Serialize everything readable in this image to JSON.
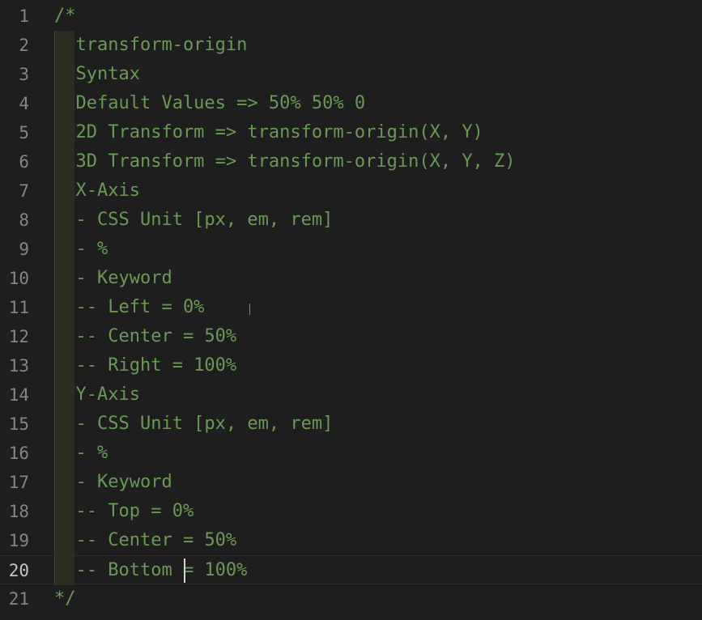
{
  "editor": {
    "current_line": 20,
    "lines": [
      {
        "n": "1",
        "text": "/*"
      },
      {
        "n": "2",
        "text": "  transform-origin"
      },
      {
        "n": "3",
        "text": "  Syntax "
      },
      {
        "n": "4",
        "text": "  Default Values => 50% 50% 0"
      },
      {
        "n": "5",
        "text": "  2D Transform => transform-origin(X, Y)"
      },
      {
        "n": "6",
        "text": "  3D Transform => transform-origin(X, Y, Z)"
      },
      {
        "n": "7",
        "text": "  X-Axis"
      },
      {
        "n": "8",
        "text": "  - CSS Unit [px, em, rem]"
      },
      {
        "n": "9",
        "text": "  - %"
      },
      {
        "n": "10",
        "text": "  - Keyword"
      },
      {
        "n": "11",
        "text": "  -- Left = 0%"
      },
      {
        "n": "12",
        "text": "  -- Center = 50%"
      },
      {
        "n": "13",
        "text": "  -- Right = 100%"
      },
      {
        "n": "14",
        "text": "  Y-Axis"
      },
      {
        "n": "15",
        "text": "  - CSS Unit [px, em, rem]"
      },
      {
        "n": "16",
        "text": "  - %"
      },
      {
        "n": "17",
        "text": "  - Keyword"
      },
      {
        "n": "18",
        "text": "  -- Top = 0%"
      },
      {
        "n": "19",
        "text": "  -- Center = 50%"
      },
      {
        "n": "20",
        "text": "  -- Bottom = 100%"
      },
      {
        "n": "21",
        "text": "*/"
      }
    ]
  },
  "colors": {
    "background": "#1e1e1e",
    "comment": "#6a9955",
    "gutter": "#858585",
    "gutter_active": "#c6c6c6"
  }
}
